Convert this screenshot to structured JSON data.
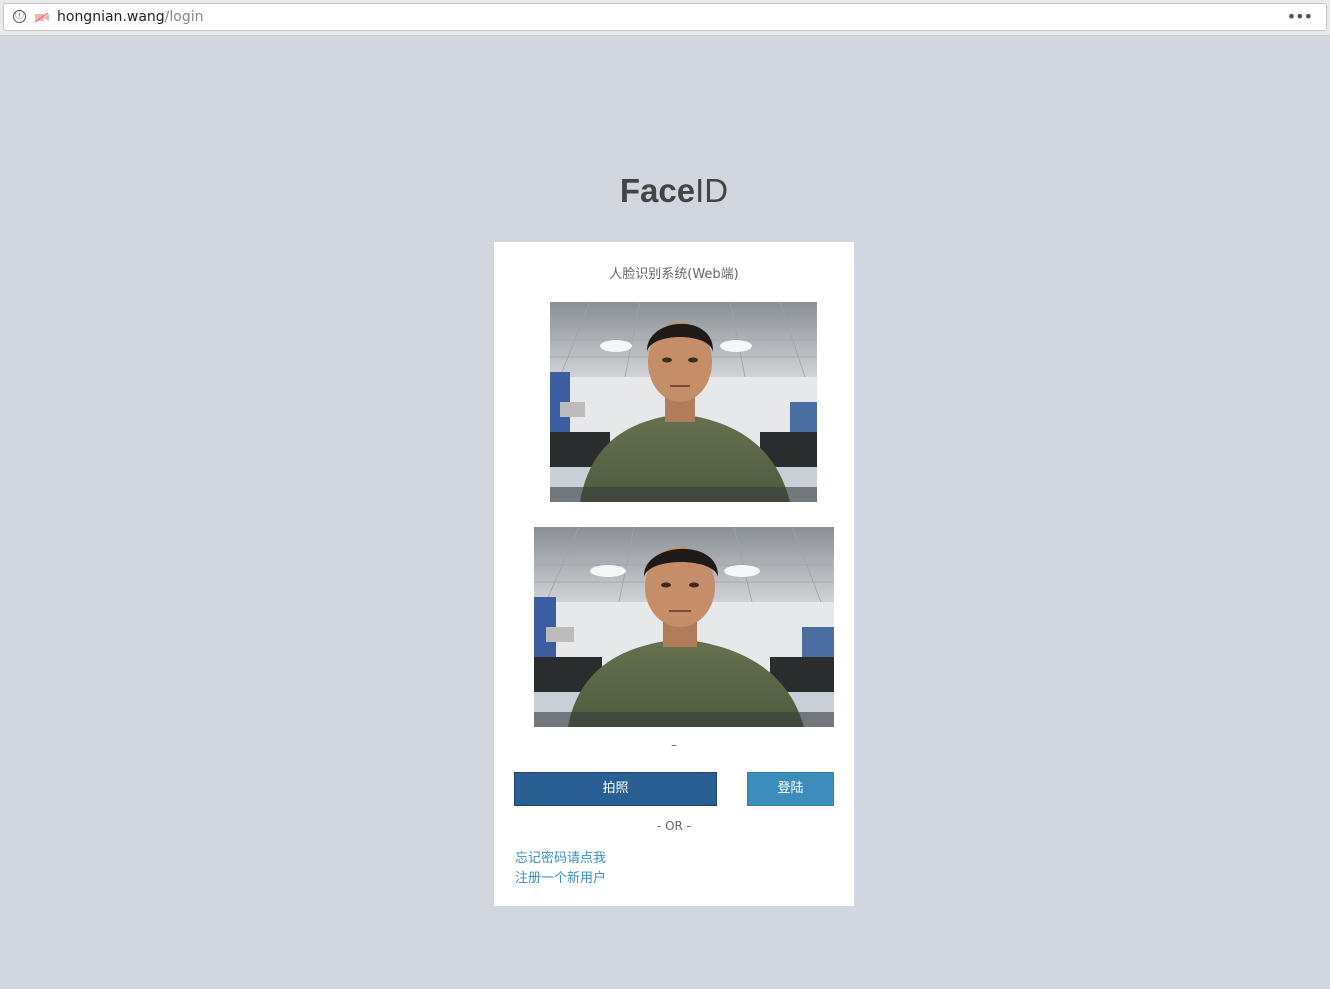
{
  "browser": {
    "url_host": "hongnian.wang",
    "url_path": "/login",
    "info_icon": "ⓘ",
    "menu_label": "•••"
  },
  "logo": {
    "bold": "Face",
    "light": "ID"
  },
  "login_box": {
    "message": "人脸识别系统(Web端)",
    "status": "–",
    "capture_button": "拍照",
    "login_button": "登陆",
    "or_divider": "- OR -",
    "forgot_password_link": "忘记密码请点我",
    "register_link": "注册一个新用户"
  },
  "colors": {
    "page_bg": "#d2d6de",
    "capture_button_bg": "#2a5f94",
    "login_button_bg": "#3c8dbc",
    "link": "#3c8dbc"
  },
  "icons": [
    "info-icon",
    "camera-blocked-icon",
    "menu-dots-icon"
  ]
}
